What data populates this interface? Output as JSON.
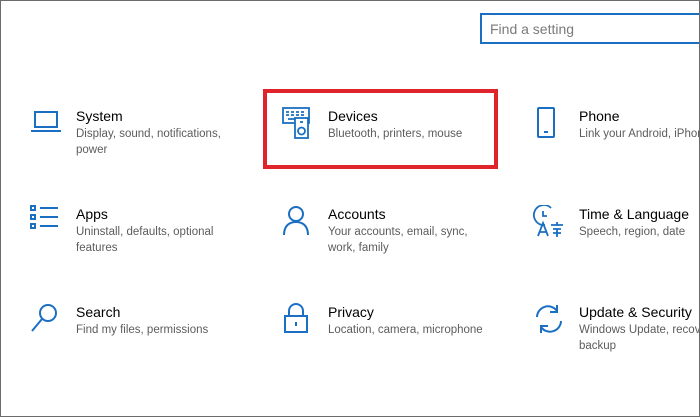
{
  "search": {
    "placeholder": "Find a setting"
  },
  "colors": {
    "accent": "#1a6fc2",
    "highlight": "#e0242c"
  },
  "tiles": [
    {
      "title": "System",
      "desc": "Display, sound, notifications, power",
      "icon": "laptop-icon"
    },
    {
      "title": "Devices",
      "desc": "Bluetooth, printers, mouse",
      "icon": "devices-icon"
    },
    {
      "title": "Phone",
      "desc": "Link your Android, iPhone",
      "icon": "phone-icon"
    },
    {
      "title": "Apps",
      "desc": "Uninstall, defaults, optional features",
      "icon": "apps-icon"
    },
    {
      "title": "Accounts",
      "desc": "Your accounts, email, sync, work, family",
      "icon": "person-icon"
    },
    {
      "title": "Time & Language",
      "desc": "Speech, region, date",
      "icon": "time-language-icon"
    },
    {
      "title": "Search",
      "desc": "Find my files, permissions",
      "icon": "search-icon"
    },
    {
      "title": "Privacy",
      "desc": "Location, camera, microphone",
      "icon": "lock-icon"
    },
    {
      "title": "Update & Security",
      "desc": "Windows Update, recovery, backup",
      "icon": "update-icon"
    }
  ]
}
